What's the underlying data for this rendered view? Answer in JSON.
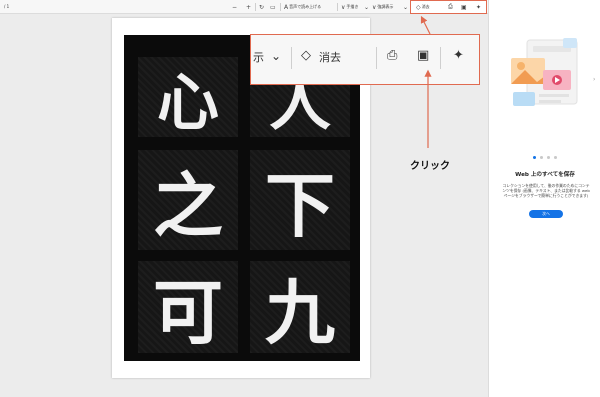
{
  "toolbar": {
    "page_indicator": "/ 1",
    "zoom_out": "−",
    "zoom_in": "+",
    "read_aloud": "音声で読み上げる",
    "draw": "手描き",
    "highlight": "強調表示",
    "erase": "消去"
  },
  "zoom_panel": {
    "partial_label": "示",
    "erase": "消去"
  },
  "annotation": {
    "click_label": "クリック"
  },
  "document": {
    "characters": [
      "心",
      "人",
      "之",
      "下",
      "可",
      "九"
    ]
  },
  "sidebar": {
    "title": "Web 上のすべてを保存",
    "description": "コレクションを使用して、後の作業のためにコンテンツを保存 (画像、テキスト、または比較する web ページをブラウザーで簡単に行うことができます)",
    "button_label": "次へ",
    "dots": 4,
    "active_dot": 0
  },
  "colors": {
    "annotation": "#e06a50",
    "accent": "#1473e6"
  }
}
